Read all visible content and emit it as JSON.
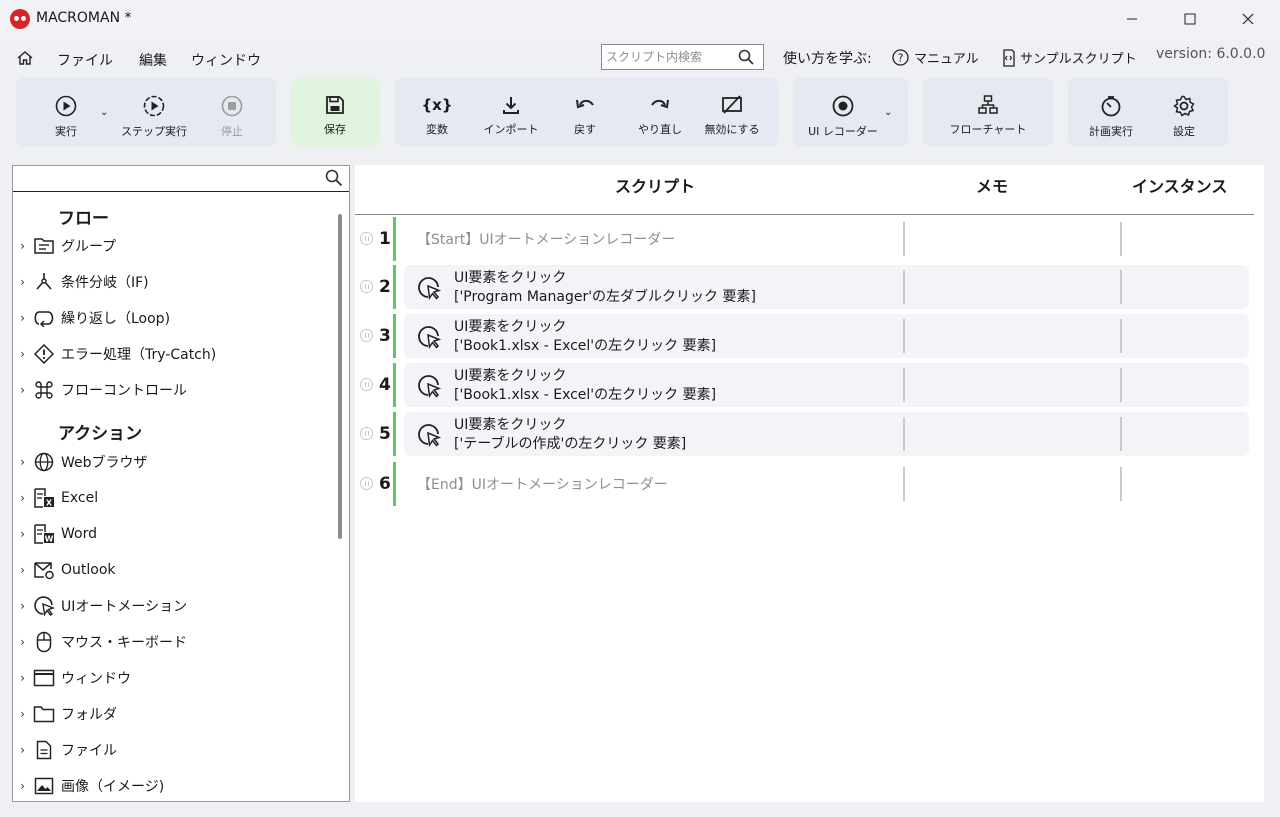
{
  "window": {
    "title": "MACROMAN *",
    "controls": [
      "minimize-icon",
      "maximize-icon",
      "close-icon"
    ]
  },
  "menu": {
    "items": [
      "ファイル",
      "編集",
      "ウィンドウ"
    ],
    "search_placeholder": "スクリプト内検索",
    "learn_label": "使い方を学ぶ:",
    "manual_label": "マニュアル",
    "sample_label": "サンプルスクリプト",
    "version": "version: 6.0.0.0"
  },
  "toolbar": {
    "run": "実行",
    "step_run": "ステップ実行",
    "stop": "停止",
    "save": "保存",
    "variable": "変数",
    "import": "インポート",
    "undo": "戻す",
    "redo": "やり直し",
    "disable": "無効にする",
    "ui_recorder": "UI レコーダー",
    "flowchart": "フローチャート",
    "schedule": "計画実行",
    "settings": "設定"
  },
  "sidebar": {
    "search_value": "",
    "flow_heading": "フロー",
    "flow_items": [
      {
        "label": "グループ",
        "icon": "group-icon"
      },
      {
        "label": "条件分岐（IF)",
        "icon": "branch-icon"
      },
      {
        "label": "繰り返し（Loop)",
        "icon": "loop-icon"
      },
      {
        "label": "エラー処理（Try-Catch)",
        "icon": "warning-icon"
      },
      {
        "label": "フローコントロール",
        "icon": "command-icon"
      }
    ],
    "action_heading": "アクション",
    "action_items": [
      {
        "label": "Webブラウザ",
        "icon": "globe-icon"
      },
      {
        "label": "Excel",
        "icon": "excel-icon"
      },
      {
        "label": "Word",
        "icon": "word-icon"
      },
      {
        "label": "Outlook",
        "icon": "outlook-icon"
      },
      {
        "label": "UIオートメーション",
        "icon": "ui-click-icon"
      },
      {
        "label": "マウス・キーボード",
        "icon": "mouse-icon"
      },
      {
        "label": "ウィンドウ",
        "icon": "window-icon"
      },
      {
        "label": "フォルダ",
        "icon": "folder-icon"
      },
      {
        "label": "ファイル",
        "icon": "file-icon"
      },
      {
        "label": "画像（イメージ)",
        "icon": "image-icon"
      }
    ]
  },
  "script": {
    "columns": {
      "script": "スクリプト",
      "memo": "メモ",
      "instance": "インスタンス"
    },
    "rows": [
      {
        "num": "1",
        "boundary": "【Start】UIオートメーションレコーダー"
      },
      {
        "num": "2",
        "line1": "UI要素をクリック",
        "line2": "['Program Manager'の左ダブルクリック 要素]"
      },
      {
        "num": "3",
        "line1": "UI要素をクリック",
        "line2": "['Book1.xlsx - Excel'の左クリック 要素]"
      },
      {
        "num": "4",
        "line1": "UI要素をクリック",
        "line2": "['Book1.xlsx - Excel'の左クリック 要素]"
      },
      {
        "num": "5",
        "line1": "UI要素をクリック",
        "line2": "['テーブルの作成'の左クリック 要素]"
      },
      {
        "num": "6",
        "boundary": "【End】UIオートメーションレコーダー"
      }
    ]
  },
  "colors": {
    "accent_green": "#5fc86b",
    "save_bg": "#dff3de",
    "toolbar_bg": "#e4e9f2",
    "logo_red": "#d9232b"
  }
}
